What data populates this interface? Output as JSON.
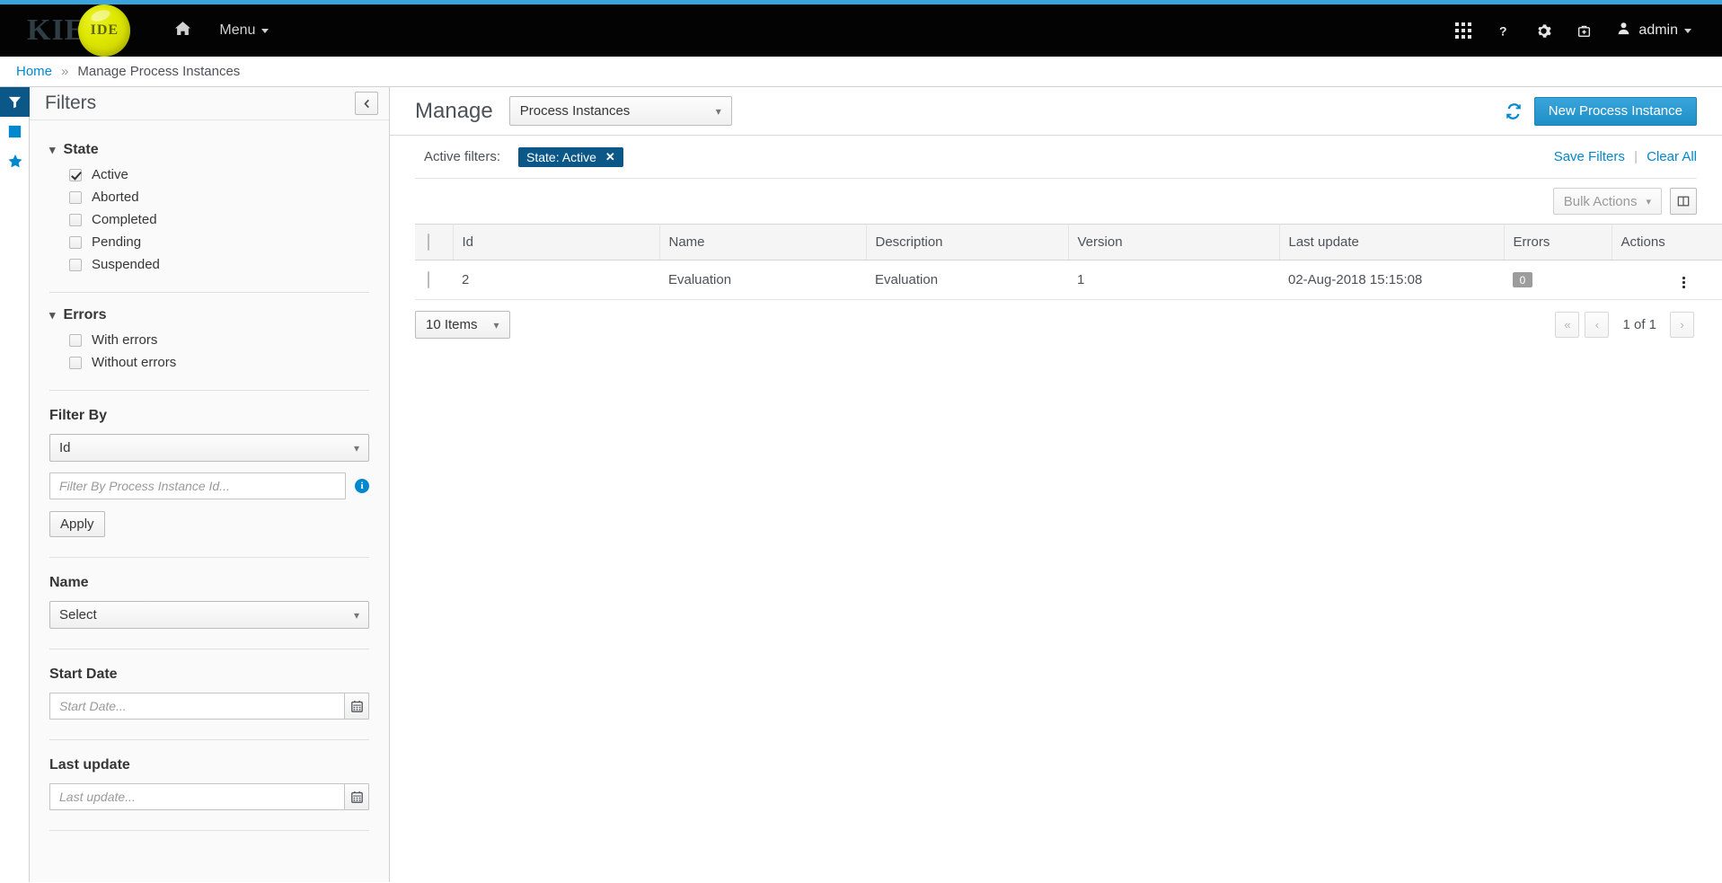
{
  "brand": {
    "kie": "KIE",
    "ide": "IDE"
  },
  "navbar": {
    "home_icon": "home-icon",
    "menu_label": "Menu",
    "icons": [
      {
        "name": "apps-grid-icon",
        "glyph": "grid"
      },
      {
        "name": "help-question-icon",
        "glyph": "?"
      },
      {
        "name": "settings-gear-icon",
        "glyph": "gear"
      },
      {
        "name": "toolbox-icon",
        "glyph": "toolbox"
      }
    ],
    "user": "admin"
  },
  "breadcrumb": {
    "home": "Home",
    "separator": "»",
    "current": "Manage Process Instances"
  },
  "rail": [
    {
      "name": "filters-tab",
      "icon": "filter-icon",
      "active": true
    },
    {
      "name": "new-filter-tab",
      "icon": "plus-square-icon",
      "active": false
    },
    {
      "name": "saved-filters-tab",
      "icon": "star-icon",
      "active": false
    }
  ],
  "filters": {
    "title": "Filters",
    "collapse_icon": "chevron-left-icon",
    "sections": [
      {
        "title": "State",
        "options": [
          {
            "label": "Active",
            "checked": true
          },
          {
            "label": "Aborted",
            "checked": false
          },
          {
            "label": "Completed",
            "checked": false
          },
          {
            "label": "Pending",
            "checked": false
          },
          {
            "label": "Suspended",
            "checked": false
          }
        ]
      },
      {
        "title": "Errors",
        "options": [
          {
            "label": "With errors",
            "checked": false
          },
          {
            "label": "Without errors",
            "checked": false
          }
        ]
      }
    ],
    "filter_by": {
      "label": "Filter By",
      "select_value": "Id",
      "input_placeholder": "Filter By Process Instance Id...",
      "info_icon": "info-circle-icon",
      "apply_label": "Apply"
    },
    "name": {
      "label": "Name",
      "select_value": "Select"
    },
    "start_date": {
      "label": "Start Date",
      "placeholder": "Start Date...",
      "icon": "calendar-icon"
    },
    "last_update": {
      "label": "Last update",
      "placeholder": "Last update...",
      "icon": "calendar-icon"
    }
  },
  "content": {
    "title": "Manage",
    "perspective_value": "Process Instances",
    "refresh_icon": "refresh-icon",
    "new_instance_label": "New Process Instance",
    "active_filters_label": "Active filters:",
    "chips": [
      {
        "label": "State: Active",
        "close": "✕"
      }
    ],
    "save_filters_label": "Save Filters",
    "clear_all_label": "Clear All",
    "separator": "|",
    "bulk_actions_label": "Bulk Actions",
    "column-toggle-icon": "columns-icon",
    "table": {
      "columns": [
        "Id",
        "Name",
        "Description",
        "Version",
        "Last update",
        "Errors",
        "Actions"
      ],
      "rows": [
        {
          "id": "2",
          "name": "Evaluation",
          "description": "Evaluation",
          "version": "1",
          "last_update": "02-Aug-2018 15:15:08",
          "errors": "0",
          "actions_icon": "kebab-menu-icon"
        }
      ]
    },
    "pagination": {
      "page_size": "10 Items",
      "first": "«",
      "prev": "‹",
      "label": "1 of 1",
      "next": "›"
    }
  },
  "colors": {
    "accent_blue": "#0088ce",
    "top_accent": "#39a5dc",
    "navbar_bg": "#030303",
    "chip_bg": "#0b5888",
    "brand_yellow": "#dfe800",
    "error_badge": "#9c9c9c"
  }
}
